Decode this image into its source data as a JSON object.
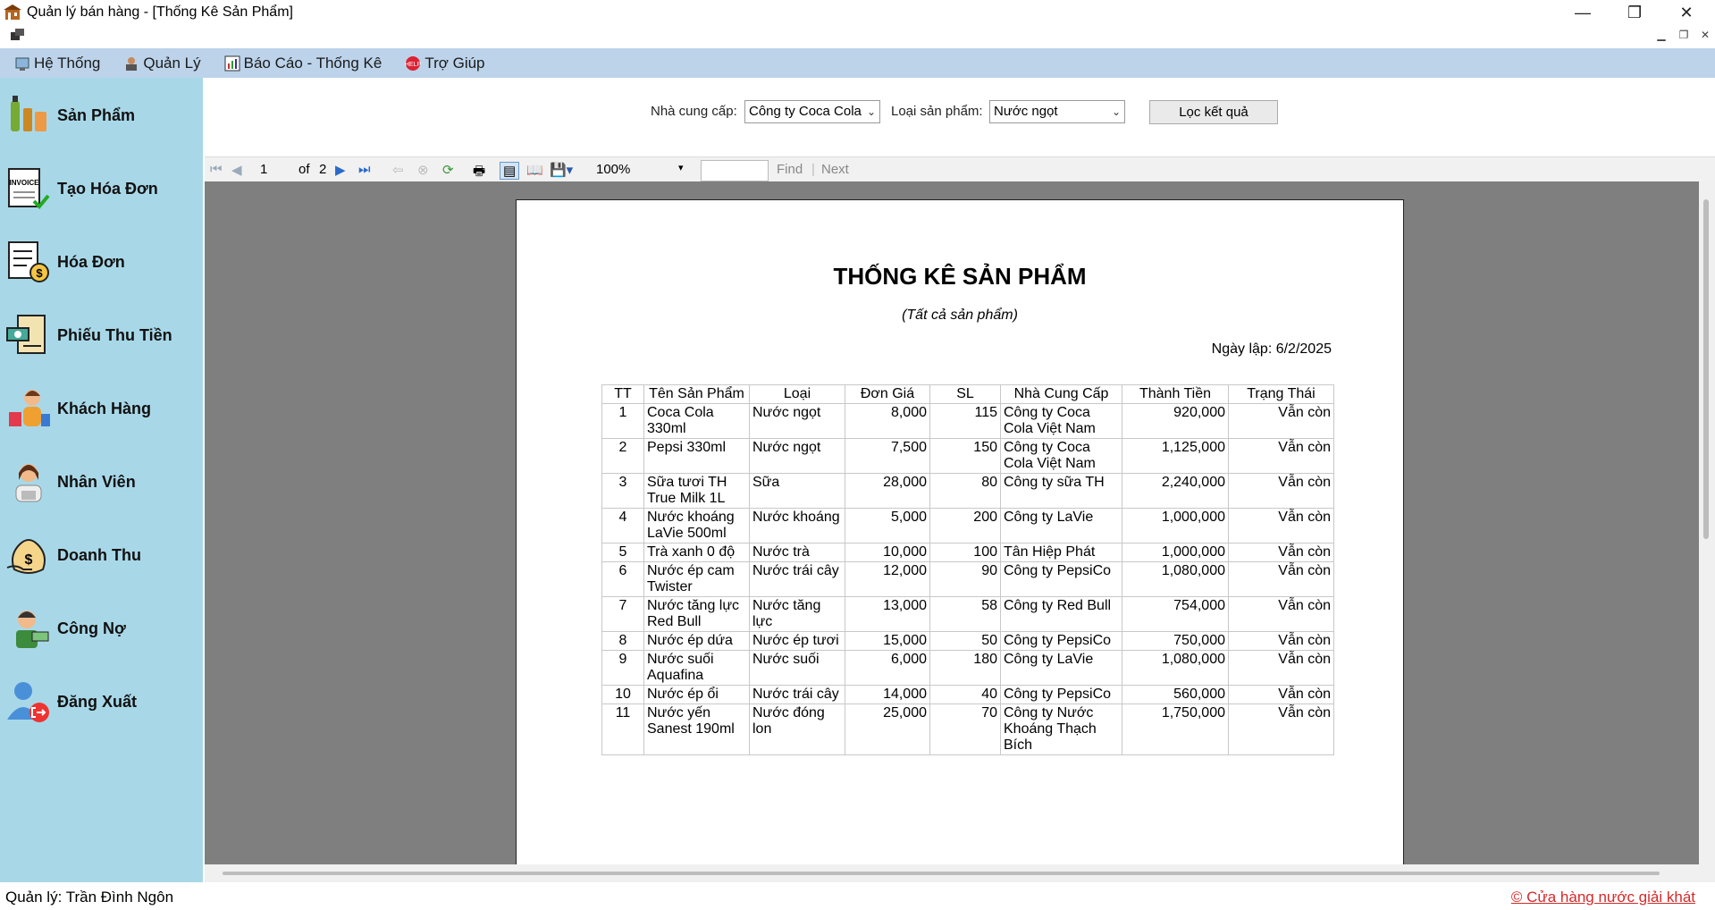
{
  "window": {
    "title": "Quản lý bán hàng - [Thống Kê Sản Phẩm]",
    "minimize": "—",
    "maximize": "❐",
    "close": "✕"
  },
  "menu": {
    "items": [
      "Hệ Thống",
      "Quản Lý",
      "Báo Cáo - Thống Kê",
      "Trợ Giúp"
    ]
  },
  "sidebar": {
    "items": [
      "Sản Phẩm",
      "Tạo Hóa Đơn",
      "Hóa Đơn",
      "Phiếu Thu Tiền",
      "Khách Hàng",
      "Nhân Viên",
      "Doanh Thu",
      "Công Nợ",
      "Đăng Xuất"
    ]
  },
  "filter": {
    "supplier_label": "Nhà cung cấp:",
    "supplier_value": "Công ty Coca Cola",
    "type_label": "Loại sản phẩm:",
    "type_value": "Nước ngọt",
    "button": "Lọc kết quả"
  },
  "viewer": {
    "page": "1",
    "of_label": "of",
    "total": "2",
    "zoom": "100%",
    "find": "Find",
    "next": "Next"
  },
  "report": {
    "title": "THỐNG KÊ SẢN PHẨM",
    "subtitle": "(Tất cả sản phẩm)",
    "date": "Ngày lập: 6/2/2025",
    "headers": [
      "TT",
      "Tên Sản Phẩm",
      "Loại",
      "Đơn Giá",
      "SL",
      "Nhà Cung Cấp",
      "Thành Tiền",
      "Trạng Thái"
    ],
    "rows": [
      [
        "1",
        "Coca Cola 330ml",
        "Nước ngọt",
        "8,000",
        "115",
        "Công ty Coca Cola Việt Nam",
        "920,000",
        "Vẫn còn"
      ],
      [
        "2",
        "Pepsi 330ml",
        "Nước ngọt",
        "7,500",
        "150",
        "Công ty Coca Cola Việt Nam",
        "1,125,000",
        "Vẫn còn"
      ],
      [
        "3",
        "Sữa tươi TH True Milk 1L",
        "Sữa",
        "28,000",
        "80",
        "Công ty sữa TH",
        "2,240,000",
        "Vẫn còn"
      ],
      [
        "4",
        "Nước khoáng LaVie 500ml",
        "Nước khoáng",
        "5,000",
        "200",
        "Công ty LaVie",
        "1,000,000",
        "Vẫn còn"
      ],
      [
        "5",
        "Trà xanh 0 độ",
        "Nước trà",
        "10,000",
        "100",
        "Tân Hiệp Phát",
        "1,000,000",
        "Vẫn còn"
      ],
      [
        "6",
        "Nước ép cam Twister",
        "Nước trái cây",
        "12,000",
        "90",
        "Công ty PepsiCo",
        "1,080,000",
        "Vẫn còn"
      ],
      [
        "7",
        "Nước tăng lực Red Bull",
        "Nước tăng lực",
        "13,000",
        "58",
        "Công ty Red Bull",
        "754,000",
        "Vẫn còn"
      ],
      [
        "8",
        "Nước ép dứa",
        "Nước ép tươi",
        "15,000",
        "50",
        "Công ty PepsiCo",
        "750,000",
        "Vẫn còn"
      ],
      [
        "9",
        "Nước suối Aquafina",
        "Nước suối",
        "6,000",
        "180",
        "Công ty LaVie",
        "1,080,000",
        "Vẫn còn"
      ],
      [
        "10",
        "Nước ép ổi",
        "Nước trái cây",
        "14,000",
        "40",
        "Công ty PepsiCo",
        "560,000",
        "Vẫn còn"
      ],
      [
        "11",
        "Nước yến Sanest 190ml",
        "Nước đóng lon",
        "25,000",
        "70",
        "Công ty Nước Khoáng Thạch Bích",
        "1,750,000",
        "Vẫn còn"
      ]
    ]
  },
  "status": {
    "manager": "Quản lý: Trần Đình Ngôn",
    "store": "© Cửa hàng nước giải khát"
  },
  "colors": {
    "sidebar": "#a8d8e8",
    "menubar": "#bcd3ea",
    "viewer_bg": "#7f7f7f",
    "link": "#d42a2a"
  }
}
